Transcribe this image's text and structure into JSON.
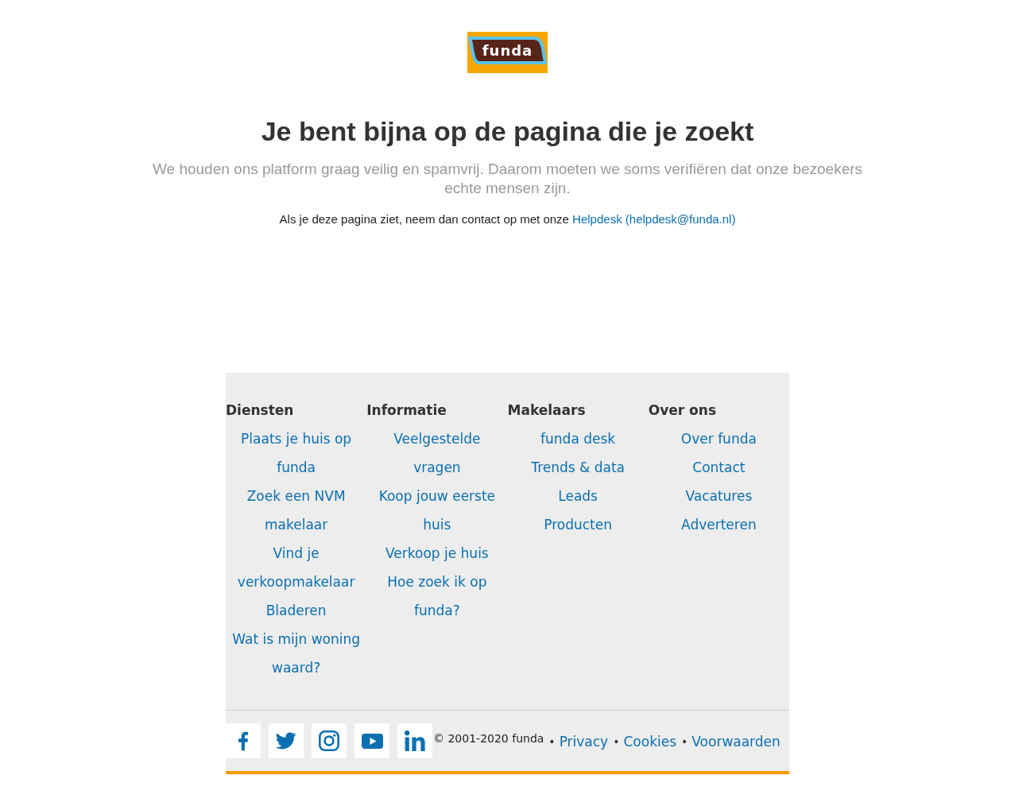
{
  "logo": {
    "text": "funda"
  },
  "heading": "Je bent bijna op de pagina die je zoekt",
  "intro": "We houden ons platform graag veilig en spamvrij. Daarom moeten we soms verifiëren dat onze bezoekers echte mensen zijn.",
  "contact": {
    "text": "Als je deze pagina ziet, neem dan contact op met onze",
    "link": "Helpdesk (helpdesk@funda.nl)"
  },
  "footer": {
    "columns": [
      {
        "title": "Diensten",
        "links": [
          "Plaats je huis op funda",
          "Zoek een NVM makelaar",
          "Vind je verkoopmakelaar",
          "Bladeren",
          "Wat is mijn woning waard?"
        ]
      },
      {
        "title": "Informatie",
        "links": [
          "Veelgestelde vragen",
          "Koop jouw eerste huis",
          "Verkoop je huis",
          "Hoe zoek ik op funda?"
        ]
      },
      {
        "title": "Makelaars",
        "links": [
          "funda desk",
          "Trends & data",
          "Leads",
          "Producten"
        ]
      },
      {
        "title": "Over ons",
        "links": [
          "Over funda",
          "Contact",
          "Vacatures",
          "Adverteren"
        ]
      }
    ],
    "social": [
      {
        "kind": "facebook"
      },
      {
        "kind": "twitter"
      },
      {
        "kind": "instagram"
      },
      {
        "kind": "youtube"
      },
      {
        "kind": "linkedin"
      }
    ],
    "copyright": "© 2001-2020 funda",
    "legal_links": [
      {
        "separator": "•",
        "label": "Privacy"
      },
      {
        "separator": "•",
        "label": "Cookies"
      },
      {
        "separator": "•",
        "label": "Voorwaarden"
      }
    ]
  }
}
